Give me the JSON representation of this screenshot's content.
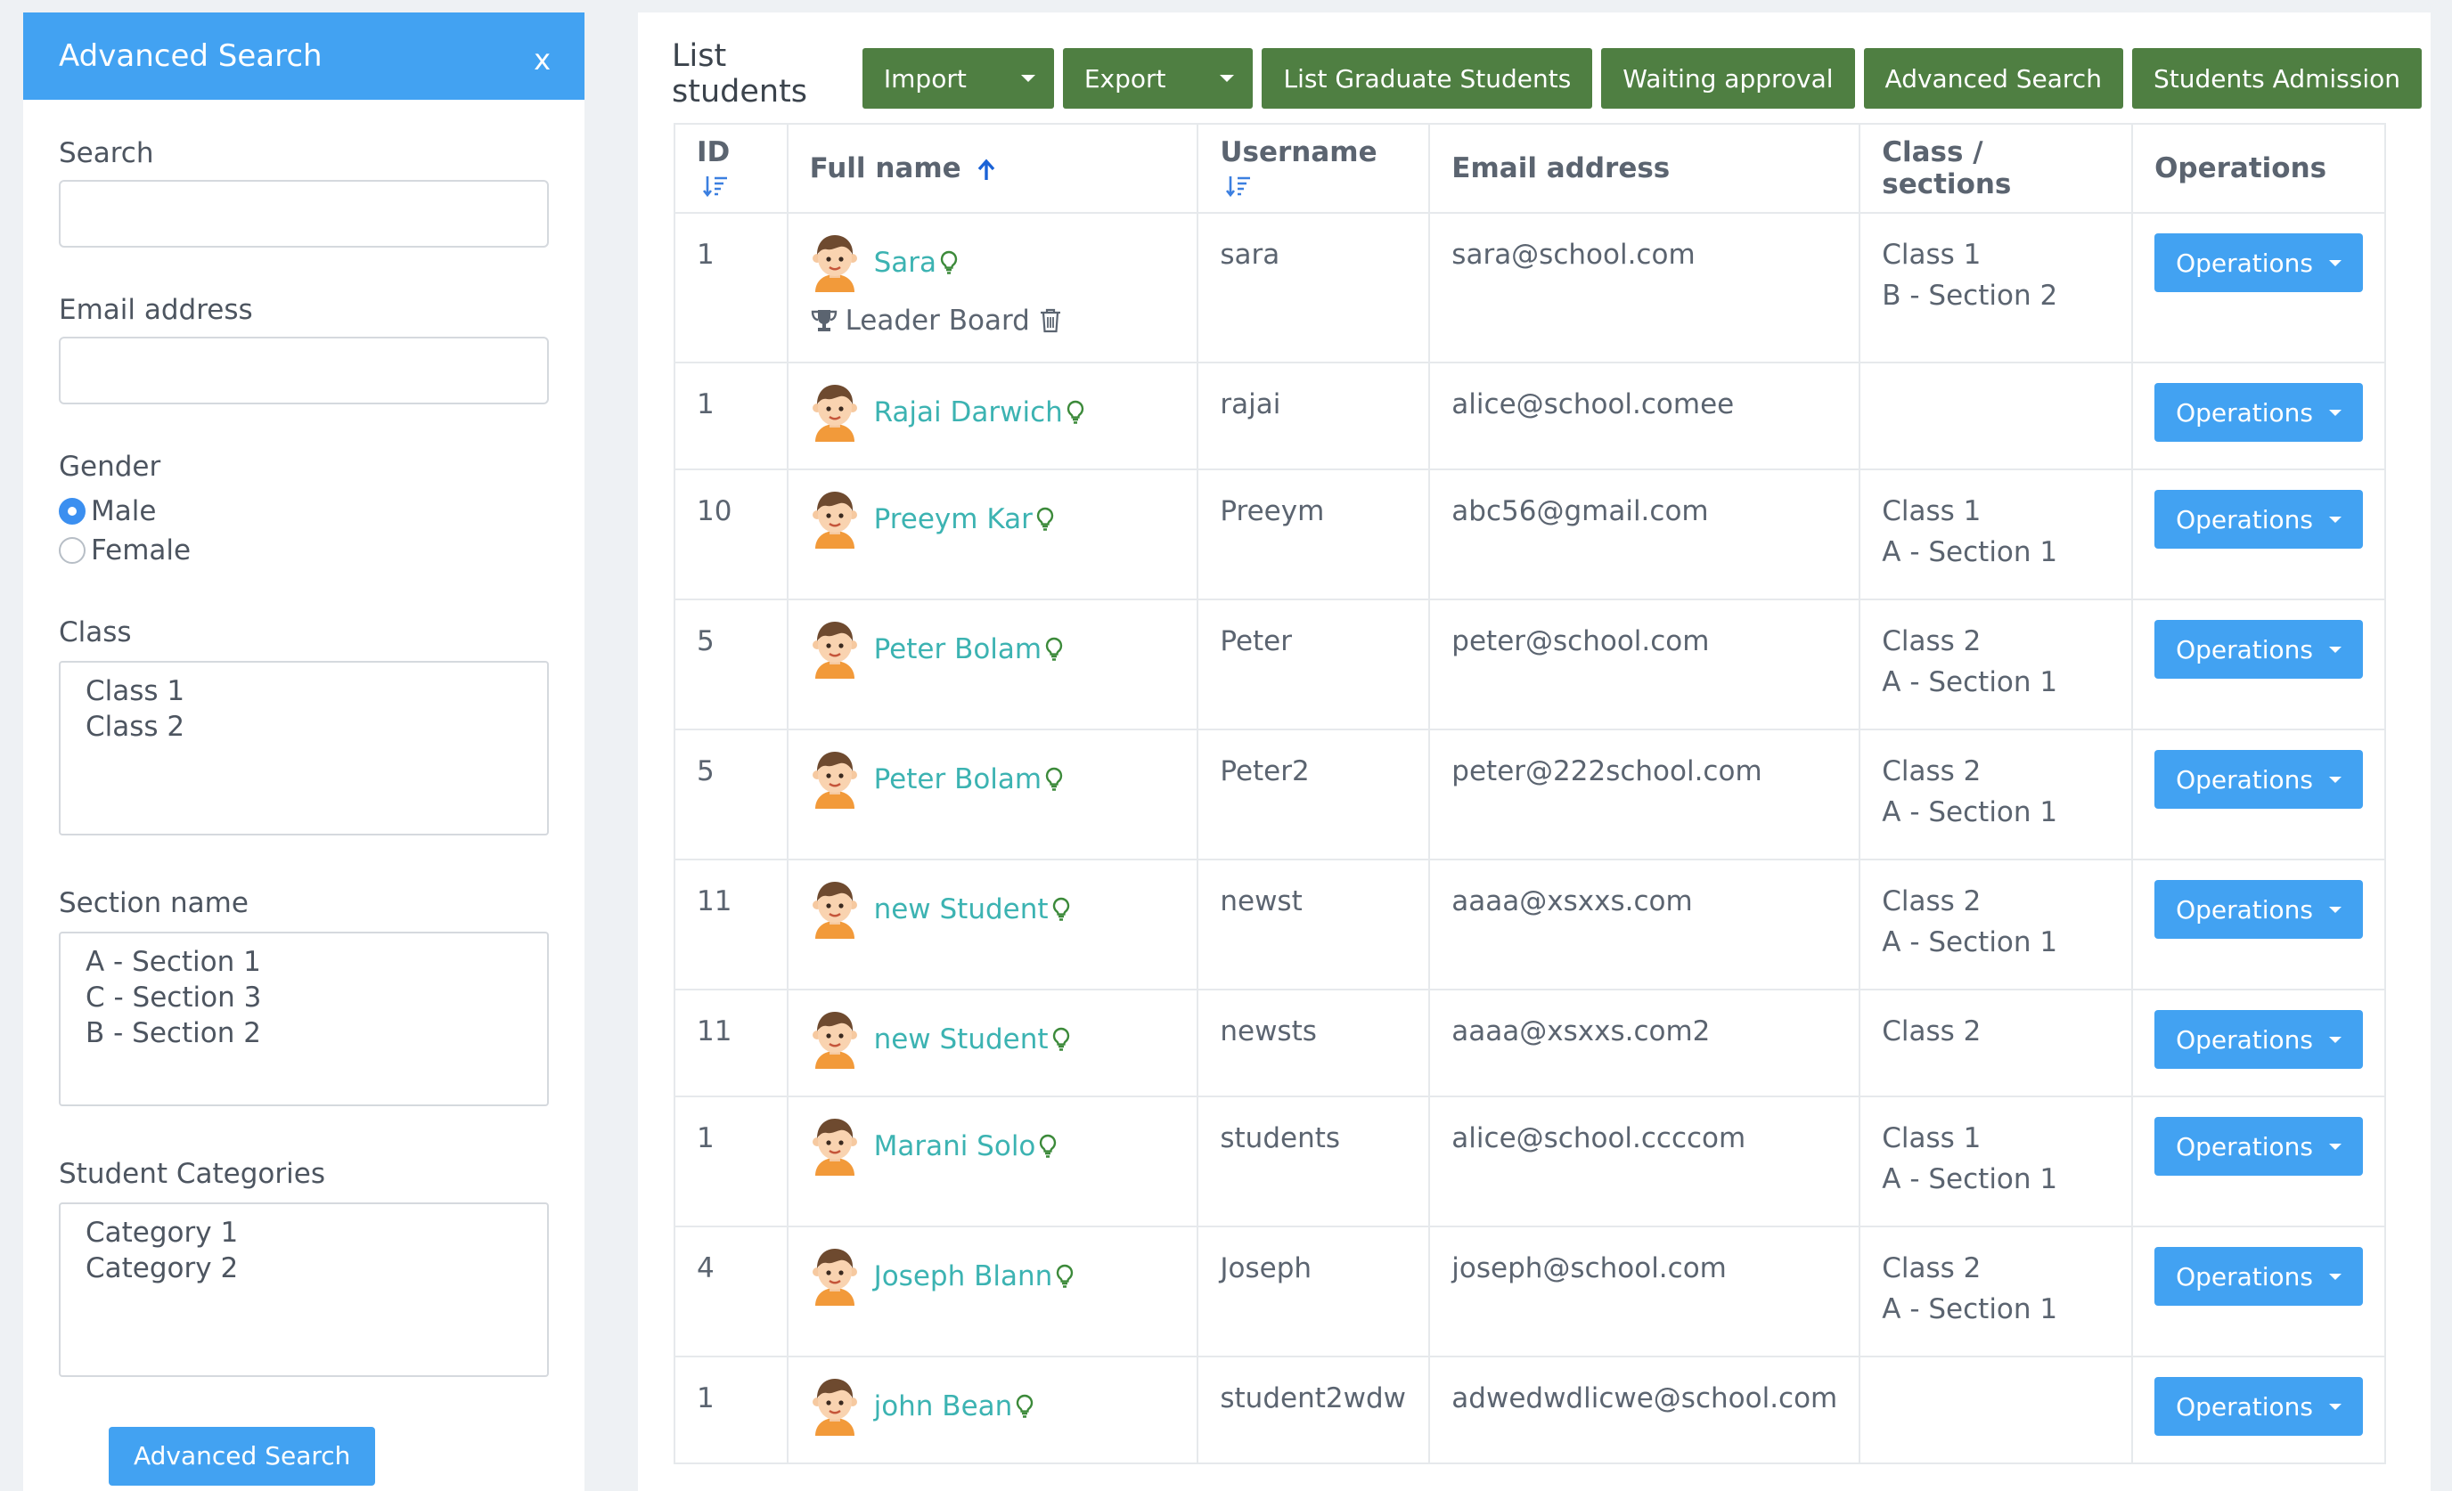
{
  "sidebar": {
    "title": "Advanced Search",
    "close": "x",
    "search_label": "Search",
    "email_label": "Email address",
    "gender_label": "Gender",
    "gender_options": [
      "Male",
      "Female"
    ],
    "gender_selected": "Male",
    "class_label": "Class",
    "class_options": [
      "Class 1",
      "Class 2"
    ],
    "section_label": "Section name",
    "section_options": [
      "A - Section 1",
      "C - Section 3",
      "B - Section 2"
    ],
    "category_label": "Student Categories",
    "category_options": [
      "Category 1",
      "Category 2"
    ],
    "submit": "Advanced Search"
  },
  "main": {
    "title": "List students",
    "buttons": {
      "import": "Import",
      "export": "Export",
      "graduates": "List Graduate Students",
      "waiting": "Waiting approval",
      "advanced": "Advanced Search",
      "admission": "Students Admission"
    },
    "columns": [
      "ID",
      "Full name",
      "Username",
      "Email address",
      "Class / sections",
      "Operations"
    ],
    "leader_board": "Leader Board",
    "ops_label": "Operations",
    "rows": [
      {
        "id": "1",
        "name": "Sara",
        "username": "sara",
        "email": "sara@school.com",
        "class": "Class 1",
        "section": "B - Section 2",
        "leader": true
      },
      {
        "id": "1",
        "name": "Rajai Darwich",
        "username": "rajai",
        "email": "alice@school.comee",
        "class": "",
        "section": ""
      },
      {
        "id": "10",
        "name": "Preeym Kar",
        "username": "Preeym",
        "email": "abc56@gmail.com",
        "class": "Class 1",
        "section": "A - Section 1"
      },
      {
        "id": "5",
        "name": "Peter Bolam",
        "username": "Peter",
        "email": "peter@school.com",
        "class": "Class 2",
        "section": "A - Section 1"
      },
      {
        "id": "5",
        "name": "Peter Bolam",
        "username": "Peter2",
        "email": "peter@222school.com",
        "class": "Class 2",
        "section": "A - Section 1"
      },
      {
        "id": "11",
        "name": "new Student",
        "username": "newst",
        "email": "aaaa@xsxxs.com",
        "class": "Class 2",
        "section": "A - Section 1"
      },
      {
        "id": "11",
        "name": "new Student",
        "username": "newsts",
        "email": "aaaa@xsxxs.com2",
        "class": "Class 2",
        "section": ""
      },
      {
        "id": "1",
        "name": "Marani Solo",
        "username": "students",
        "email": "alice@school.ccccom",
        "class": "Class 1",
        "section": "A - Section 1"
      },
      {
        "id": "4",
        "name": "Joseph Blann",
        "username": "Joseph",
        "email": "joseph@school.com",
        "class": "Class 2",
        "section": "A - Section 1"
      },
      {
        "id": "1",
        "name": "john Bean",
        "username": "student2wdw",
        "email": "adwedwdlicwe@school.com",
        "class": "",
        "section": ""
      }
    ]
  },
  "colors": {
    "primary": "#42a2f2",
    "toolbar_green": "#4f7f42",
    "link_teal": "#3cb3b2",
    "bulb_green": "#3c8a3a"
  },
  "icons": [
    "sort-icon",
    "sort-up-arrow-icon",
    "lightbulb-icon",
    "trophy-icon",
    "trash-icon",
    "avatar-icon",
    "caret-down-icon"
  ]
}
